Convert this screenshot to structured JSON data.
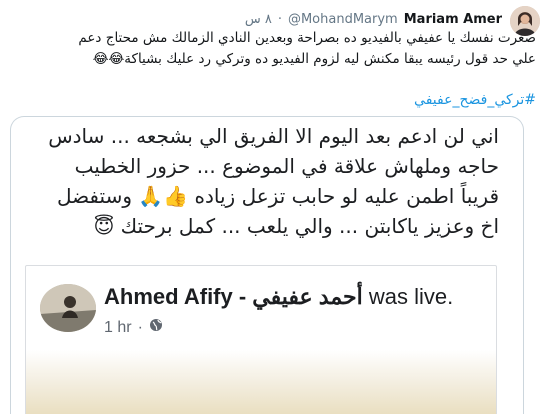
{
  "tweet": {
    "author_name": "Mariam Amer",
    "handle": "@MohandMarym",
    "time": "٨ س",
    "separator": "·",
    "text_lines": [
      "صغرت نفسك يا عفيفي بالفيديو ده بصراحة وبعدين النادي الزمالك مش محتاج دعم",
      "علي حد قول رئيسه يبقا مكنش ليه لزوم الفيديو ده وتركي رد عليك بشياكة😂😂"
    ],
    "hashtag": "#تركي_فضح_عفيفي"
  },
  "quoted_post": {
    "lines": [
      "اني لن ادعم بعد اليوم الا الفريق الي بشجعه ... سادس",
      "حاجه وملهاش علاقة في الموضوع ... حزور الخطيب",
      "قريباً اطمن عليه لو حابب تزعل زياده 👍🙏 وستفضل",
      "اخ وعزيز ياكابتن ... والي يلعب ... كمل برحتك 😇"
    ],
    "live": {
      "name": "Ahmed Afify - أحمد عفيفي",
      "status": "was live.",
      "time": "1 hr",
      "separator": "·"
    }
  },
  "icons": {
    "globe": "globe-icon",
    "avatar": "profile-avatar",
    "live_avatar": "live-profile-avatar"
  }
}
